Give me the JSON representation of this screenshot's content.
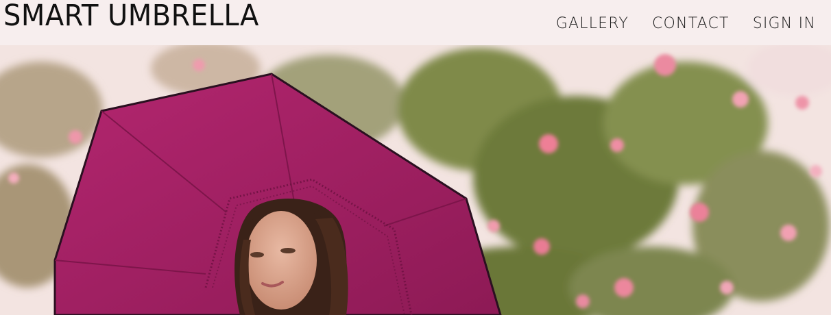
{
  "brand": {
    "title": "SMART UMBRELLA"
  },
  "nav": {
    "items": [
      "GALLERY",
      "CONTACT",
      "SIGN IN"
    ]
  },
  "colors": {
    "header_bg": "#f7eeee",
    "umbrella": "#9a1d5c",
    "foliage": "#6f7b3c",
    "blossom": "#e9869b"
  },
  "hero": {
    "icon": "photo-woman-with-umbrella"
  }
}
